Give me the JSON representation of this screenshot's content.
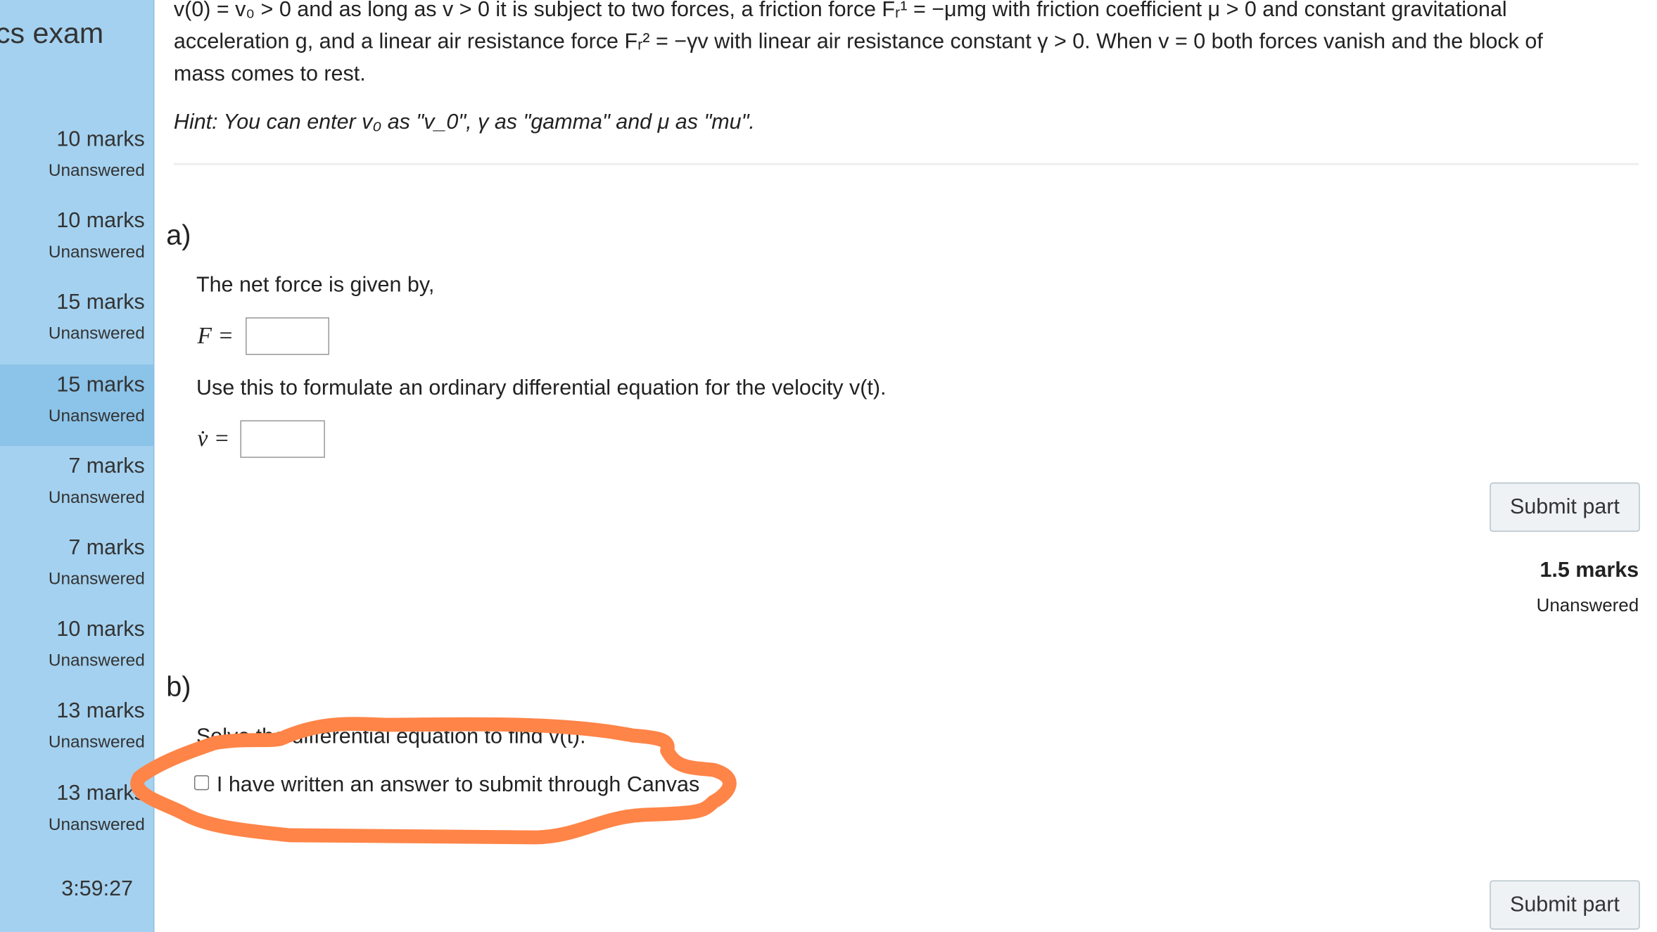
{
  "sidebar": {
    "title": "cs exam",
    "items": [
      {
        "marks": "10 marks",
        "status": "Unanswered"
      },
      {
        "marks": "10 marks",
        "status": "Unanswered"
      },
      {
        "marks": "15 marks",
        "status": "Unanswered"
      },
      {
        "marks": "15 marks",
        "status": "Unanswered",
        "active": true
      },
      {
        "marks": "7 marks",
        "status": "Unanswered"
      },
      {
        "marks": "7 marks",
        "status": "Unanswered"
      },
      {
        "marks": "10 marks",
        "status": "Unanswered"
      },
      {
        "marks": "13 marks",
        "status": "Unanswered"
      },
      {
        "marks": "13 marks",
        "status": "Unanswered"
      }
    ],
    "timer": "3:59:27"
  },
  "question": {
    "line1": "v(0) = v₀ > 0 and as long as v > 0 it is subject to two forces, a friction force Fᵣ¹ = −μmg with friction coefficient μ > 0 and constant gravitational",
    "line2": "acceleration g, and a linear air resistance force Fᵣ² = −γv with linear air resistance constant γ > 0. When v = 0 both forces vanish and the block of",
    "line3": "mass comes to rest.",
    "hint": "Hint: You can enter v₀ as \"v_0\", γ as \"gamma\" and μ as \"mu\"."
  },
  "part_a": {
    "label": "a)",
    "prompt1": "The net force is given by,",
    "f_label": "F =",
    "f_value": "",
    "prompt2": "Use this to formulate an ordinary differential equation for the velocity v(t).",
    "vdot_label": "v̇ =",
    "vdot_value": "",
    "submit": "Submit part",
    "marks": "1.5 marks",
    "status": "Unanswered"
  },
  "part_b": {
    "label": "b)",
    "prompt": "Solve the differential equation to find v(t).",
    "checkbox_label": "I have written an answer to submit through Canvas",
    "checked": false,
    "submit": "Submit part"
  },
  "annotation": {
    "color": "#ff8447"
  }
}
